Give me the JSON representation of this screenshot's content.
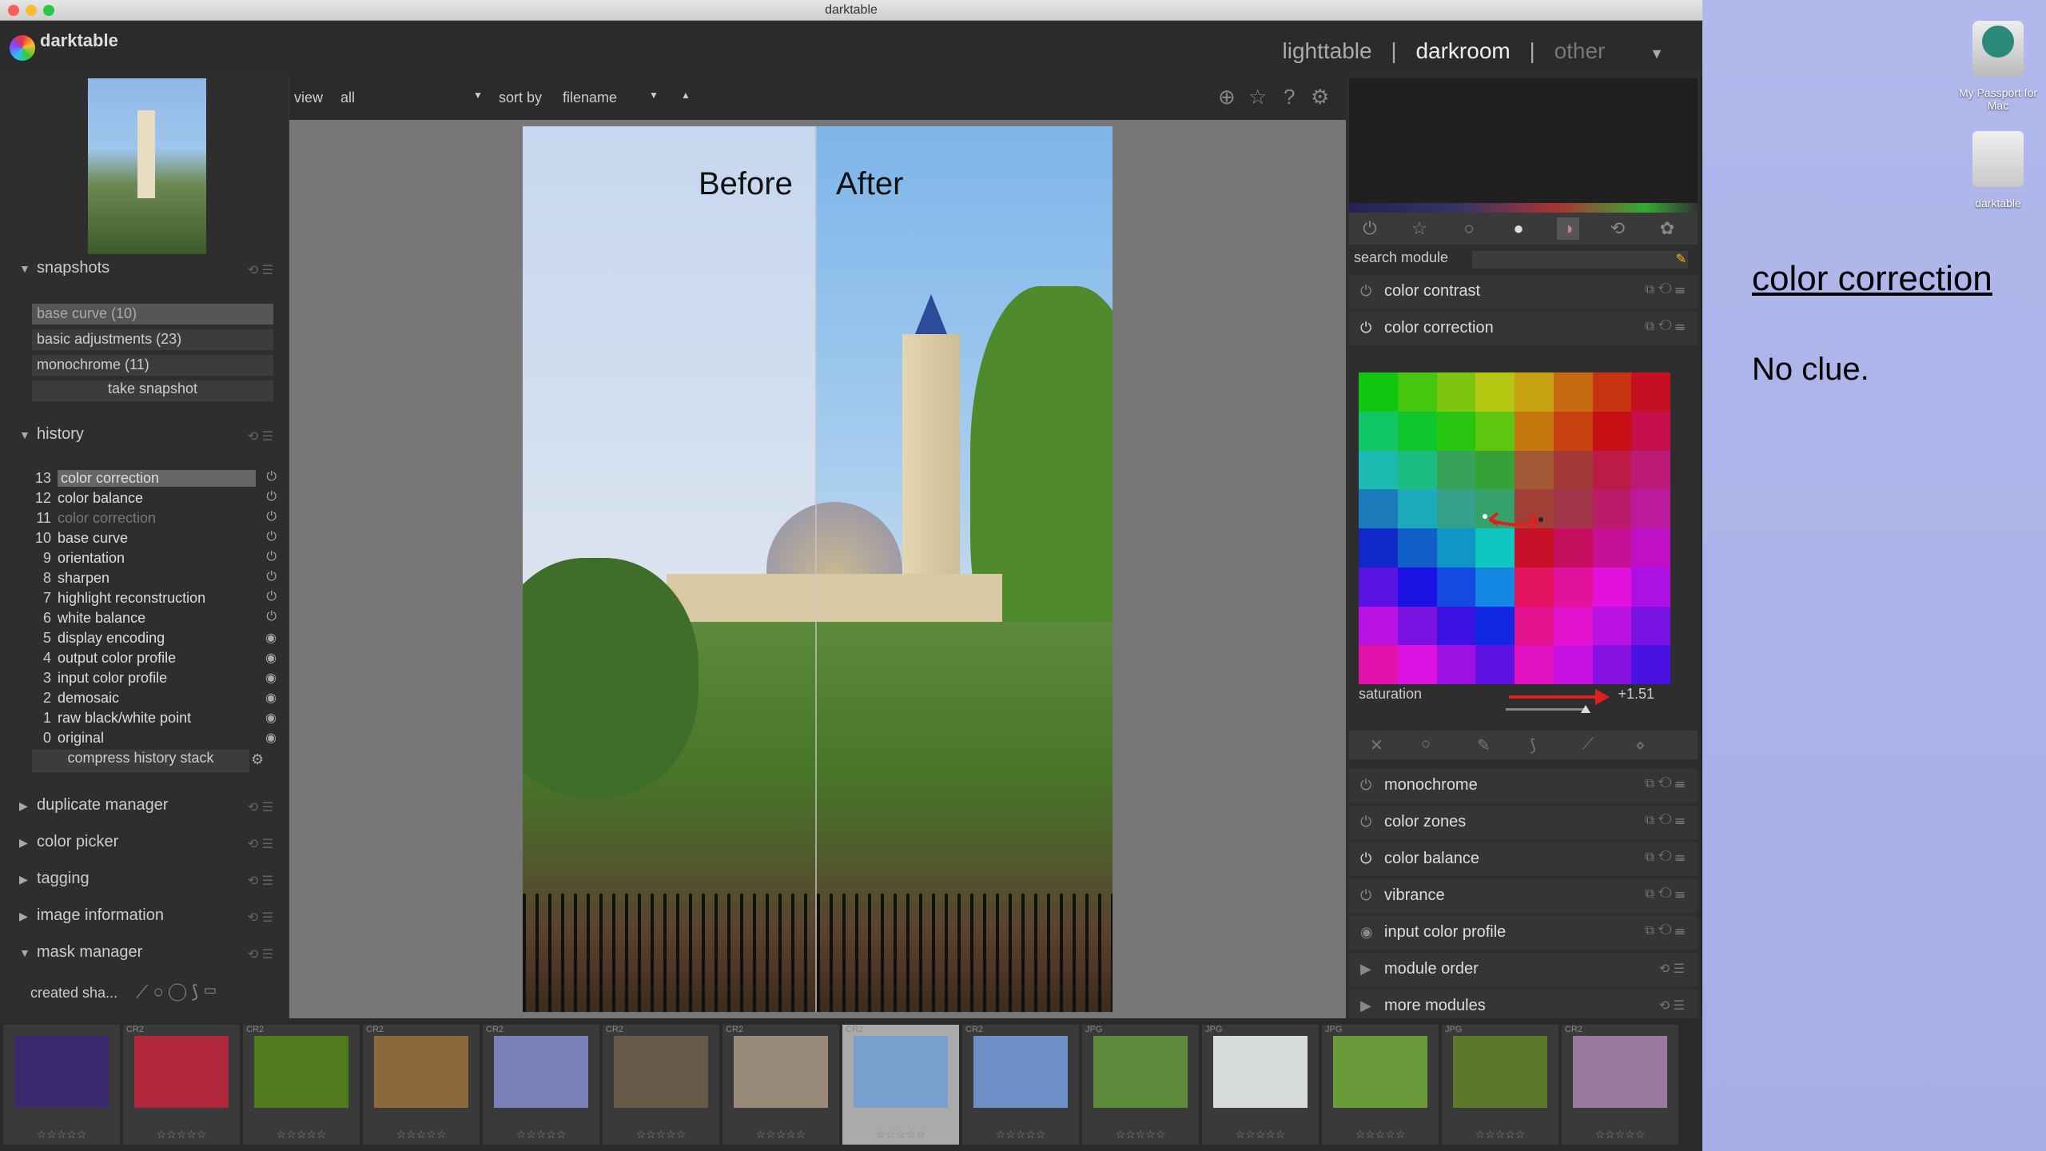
{
  "window": {
    "title": "darktable"
  },
  "app": {
    "logo_text": "darktable"
  },
  "views": {
    "lighttable": "lighttable",
    "sep": "|",
    "darkroom": "darkroom",
    "other": "other"
  },
  "topbar": {
    "view_label": "view",
    "view_value": "all",
    "sort_label": "sort by",
    "sort_value": "filename"
  },
  "snapshots": {
    "header": "snapshots",
    "items": [
      "base curve (10)",
      "basic adjustments (23)",
      "monochrome (11)"
    ],
    "take": "take snapshot"
  },
  "history": {
    "header": "history",
    "items": [
      {
        "num": "13",
        "label": "color correction"
      },
      {
        "num": "12",
        "label": "color balance"
      },
      {
        "num": "11",
        "label": "color correction"
      },
      {
        "num": "10",
        "label": "base curve"
      },
      {
        "num": "9",
        "label": "orientation"
      },
      {
        "num": "8",
        "label": "sharpen"
      },
      {
        "num": "7",
        "label": "highlight reconstruction"
      },
      {
        "num": "6",
        "label": "white balance"
      },
      {
        "num": "5",
        "label": "display encoding"
      },
      {
        "num": "4",
        "label": "output color profile"
      },
      {
        "num": "3",
        "label": "input color profile"
      },
      {
        "num": "2",
        "label": "demosaic"
      },
      {
        "num": "1",
        "label": "raw black/white point"
      },
      {
        "num": "0",
        "label": "original"
      }
    ],
    "compress": "compress history stack"
  },
  "left_modules": [
    "duplicate manager",
    "color picker",
    "tagging",
    "image information",
    "mask manager"
  ],
  "mask_manager": {
    "created": "created sha..."
  },
  "image": {
    "before": "Before",
    "after": "After"
  },
  "right": {
    "search_label": "search module",
    "modules_top": [
      "color contrast",
      "color correction"
    ],
    "saturation_label": "saturation",
    "saturation_value": "+1.51",
    "modules_bottom": [
      "monochrome",
      "color zones",
      "color balance",
      "vibrance",
      "input color profile"
    ],
    "module_order": "module order",
    "more_modules": "more modules"
  },
  "filmstrip": {
    "types": [
      "",
      "CR2",
      "CR2",
      "CR2",
      "CR2",
      "CR2",
      "CR2",
      "CR2",
      "CR2",
      "JPG",
      "JPG",
      "JPG",
      "JPG",
      "CR2"
    ],
    "colors": [
      "#3b2a6e",
      "#b0263a",
      "#4f7a1e",
      "#8a6a3a",
      "#7a80b8",
      "#6a5a4a",
      "#9a8a7a",
      "#7aa0d0",
      "#6d90c8",
      "#5d8a3a",
      "#d8dcd8",
      "#6a9a3a",
      "#5a7a2a",
      "#9a7aa0"
    ]
  },
  "desktop": {
    "drive1": "My Passport for Mac",
    "drive2": "darktable"
  },
  "annotation": {
    "title": "color correction",
    "note": "No clue."
  }
}
